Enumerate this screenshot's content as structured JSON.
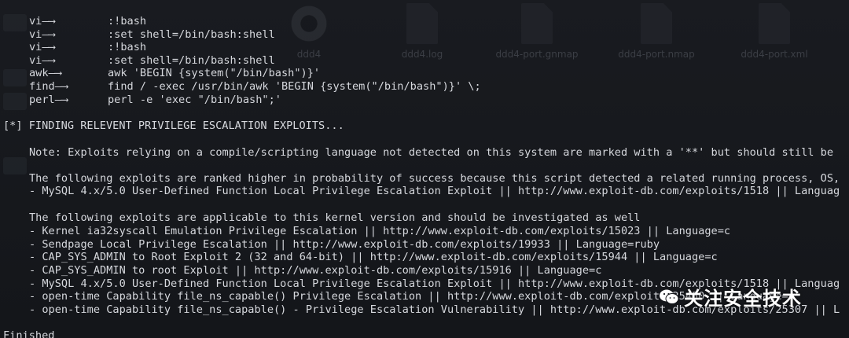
{
  "desktop": {
    "files": [
      {
        "name": "ddd4",
        "icon": "gear-icon"
      },
      {
        "name": "ddd4.log",
        "icon": "file-icon"
      },
      {
        "name": "ddd4-port.gnmap",
        "icon": "file-icon"
      },
      {
        "name": "ddd4-port.nmap",
        "icon": "file-icon"
      },
      {
        "name": "ddd4-port.xml",
        "icon": "file-icon"
      }
    ]
  },
  "terminal": {
    "escape_lines": [
      {
        "binary": "vi—⟶",
        "command": ":!bash"
      },
      {
        "binary": "vi—⟶",
        "command": ":set shell=/bin/bash:shell"
      },
      {
        "binary": "vi—⟶",
        "command": ":!bash"
      },
      {
        "binary": "vi—⟶",
        "command": ":set shell=/bin/bash:shell"
      },
      {
        "binary": "awk—⟶",
        "command": "awk 'BEGIN {system(\"/bin/bash\")}'"
      },
      {
        "binary": "find—⟶",
        "command": "find / -exec /usr/bin/awk 'BEGIN {system(\"/bin/bash\")}' \\;"
      },
      {
        "binary": "perl—⟶",
        "command": "perl -e 'exec \"/bin/bash\";'"
      }
    ],
    "section_header": "[*] FINDING RELEVENT PRIVILEGE ESCALATION EXPLOITS...",
    "note": "Note: Exploits relying on a compile/scripting language not detected on this system are marked with a '**' but should still be",
    "ranked_intro": "The following exploits are ranked higher in probability of success because this script detected a related running process, OS,",
    "ranked_exploits": [
      "- MySQL 4.x/5.0 User-Defined Function Local Privilege Escalation Exploit || http://www.exploit-db.com/exploits/1518 || Languag"
    ],
    "applicable_intro": "The following exploits are applicable to this kernel version and should be investigated as well",
    "applicable_exploits": [
      "- Kernel ia32syscall Emulation Privilege Escalation || http://www.exploit-db.com/exploits/15023 || Language=c",
      "- Sendpage Local Privilege Escalation || http://www.exploit-db.com/exploits/19933 || Language=ruby",
      "- CAP_SYS_ADMIN to Root Exploit 2 (32 and 64-bit) || http://www.exploit-db.com/exploits/15944 || Language=c",
      "- CAP_SYS_ADMIN to root Exploit || http://www.exploit-db.com/exploits/15916 || Language=c",
      "- MySQL 4.x/5.0 User-Defined Function Local Privilege Escalation Exploit || http://www.exploit-db.com/exploits/1518 || Languag",
      "- open-time Capability file_ns_capable() Privilege Escalation || http://www.exploit-db.com/exploits/25450 || Language=c",
      "- open-time Capability file_ns_capable() - Privilege Escalation Vulnerability || http://www.exploit-db.com/exploits/25307 || L"
    ],
    "finished": "Finished"
  },
  "watermark": {
    "text": "关注安全技术",
    "icon": "wechat-icon"
  },
  "colors": {
    "background": "#15171c",
    "text": "#d6d8dd",
    "watermark": "#ffffff"
  }
}
